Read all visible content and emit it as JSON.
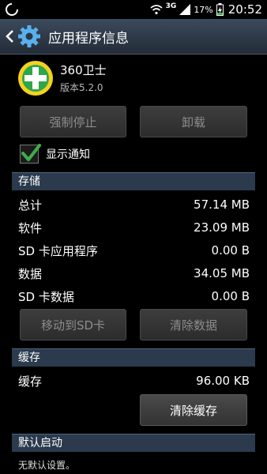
{
  "status_bar": {
    "network": "3G",
    "battery": "17%",
    "time": "20:52"
  },
  "header": {
    "title": "应用程序信息"
  },
  "app": {
    "name": "360卫士",
    "version": "版本5.2.0"
  },
  "buttons": {
    "force_stop": "强制停止",
    "uninstall": "卸载",
    "move_to_sd": "移动到SD卡",
    "clear_data": "清除数据",
    "clear_cache": "清除缓存"
  },
  "show_notifications": {
    "label": "显示通知",
    "checked": true
  },
  "storage": {
    "title": "存储",
    "rows": [
      {
        "label": "总计",
        "value": "57.14 MB"
      },
      {
        "label": "软件",
        "value": "23.09 MB"
      },
      {
        "label": "SD 卡应用程序",
        "value": "0.00 B"
      },
      {
        "label": "数据",
        "value": "34.05 MB"
      },
      {
        "label": "SD 卡数据",
        "value": "0.00 B"
      }
    ]
  },
  "cache": {
    "title": "缓存",
    "label": "缓存",
    "value": "96.00 KB"
  },
  "default_launch": {
    "title": "默认启动",
    "text": "无默认设置。"
  },
  "colors": {
    "accent_green": "#3fae49",
    "section_bg": "#2b3a4d",
    "action_bar": "#2f3b4a"
  }
}
